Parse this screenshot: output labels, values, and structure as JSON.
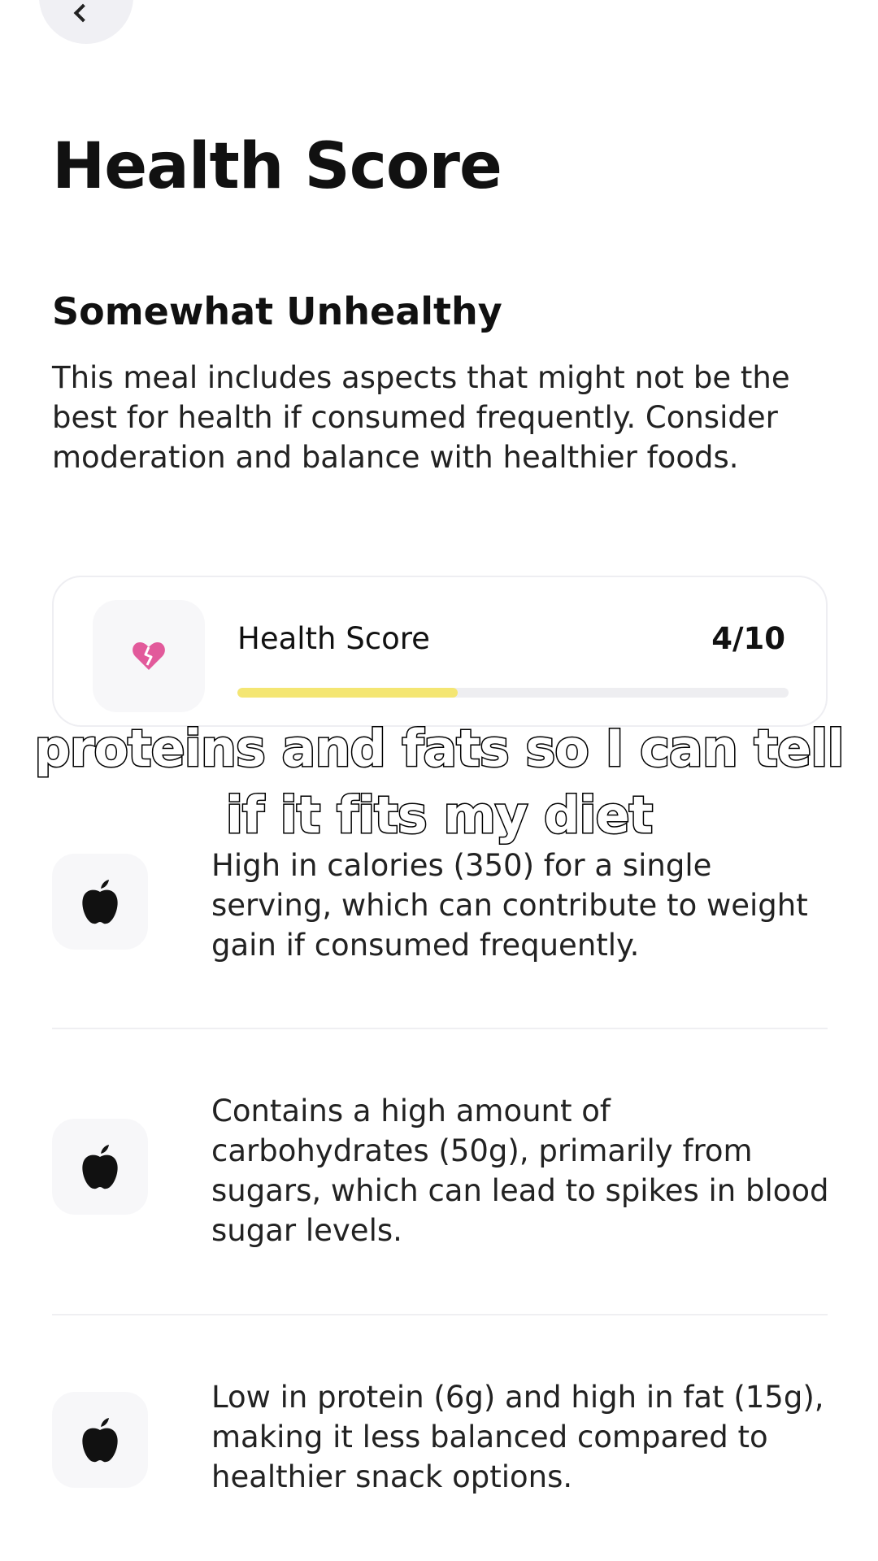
{
  "header": {
    "back_icon": "chevron-left-icon"
  },
  "title": "Health Score",
  "rating": {
    "heading": "Somewhat Unhealthy",
    "description": "This meal includes aspects that might not be the best for health if consumed frequently. Consider moderation and balance with healthier foods."
  },
  "score_card": {
    "icon": "broken-heart-icon",
    "icon_color": "#e25a9b",
    "label": "Health Score",
    "value": "4/10",
    "progress_fraction": 0.4,
    "bar_color": "#f4e673"
  },
  "caption": {
    "line1": "proteins and fats so I can tell",
    "line2": "if it fits my diet"
  },
  "reasons": [
    {
      "icon": "apple-icon",
      "text": "High in calories (350) for a single serving, which can contribute to weight gain if consumed frequently."
    },
    {
      "icon": "apple-icon",
      "text": "Contains a high amount of carbohydrates (50g), primarily from sugars, which can lead to spikes in blood sugar levels."
    },
    {
      "icon": "apple-icon",
      "text": "Low in protein (6g) and high in fat (15g), making it less balanced compared to healthier snack options."
    }
  ]
}
